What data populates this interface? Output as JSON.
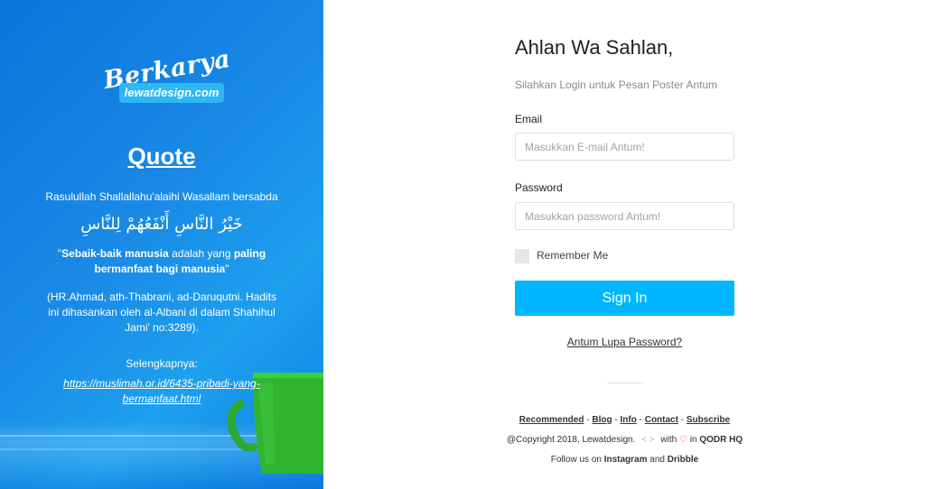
{
  "colors": {
    "accent": "#00b7ff",
    "left_panel": "#1a8ae6",
    "heart": "#e0435a"
  },
  "brand": {
    "script": "Berkarya",
    "site": "lewatdesign.com"
  },
  "quote": {
    "title": "Quote",
    "intro": "Rasulullah Shallallahu'alaihi Wasallam bersabda",
    "arabic": "خَيْرُ النَّاسِ أَنْفَعُهُمْ لِلنَّاسِ",
    "translation_open": "\"",
    "translation_bold1": "Sebaik-baik manusia",
    "translation_mid": " adalah yang ",
    "translation_bold2": "paling bermanfaat bagi manusia",
    "translation_close": "\"",
    "source": "(HR.Ahmad, ath-Thabrani, ad-Daruqutni. Hadits ini dihasankan oleh al-Albani di dalam Shahihul Jami' no:3289).",
    "more_label": "Selengkapnya:",
    "more_link": "https://muslimah.or.id/6435-pribadi-yang-bermanfaat.html"
  },
  "login": {
    "greeting": "Ahlan Wa Sahlan,",
    "subtitle": "Silahkan Login untuk Pesan Poster Antum",
    "email_label": "Email",
    "email_placeholder": "Masukkan E-mail Antum!",
    "email_value": "",
    "password_label": "Password",
    "password_placeholder": "Masukkan password Antum!",
    "password_value": "",
    "remember_label": "Remember Me",
    "remember_checked": false,
    "signin_label": "Sign In",
    "forgot_label": "Antum Lupa Password?"
  },
  "footer": {
    "links": [
      "Recommended",
      "Blog",
      "Info",
      "Contact",
      "Subscribe"
    ],
    "separator": "-",
    "copyright_text": "@Copyright 2018, Lewatdesign.",
    "code_icon": "code-icon",
    "with_text": "with",
    "heart_icon": "heart-icon",
    "in_text": "in",
    "hq": "QODR HQ",
    "follow_text": "Follow us on",
    "follow_a": "Instagram",
    "follow_and": "and",
    "follow_b": "Dribble"
  }
}
